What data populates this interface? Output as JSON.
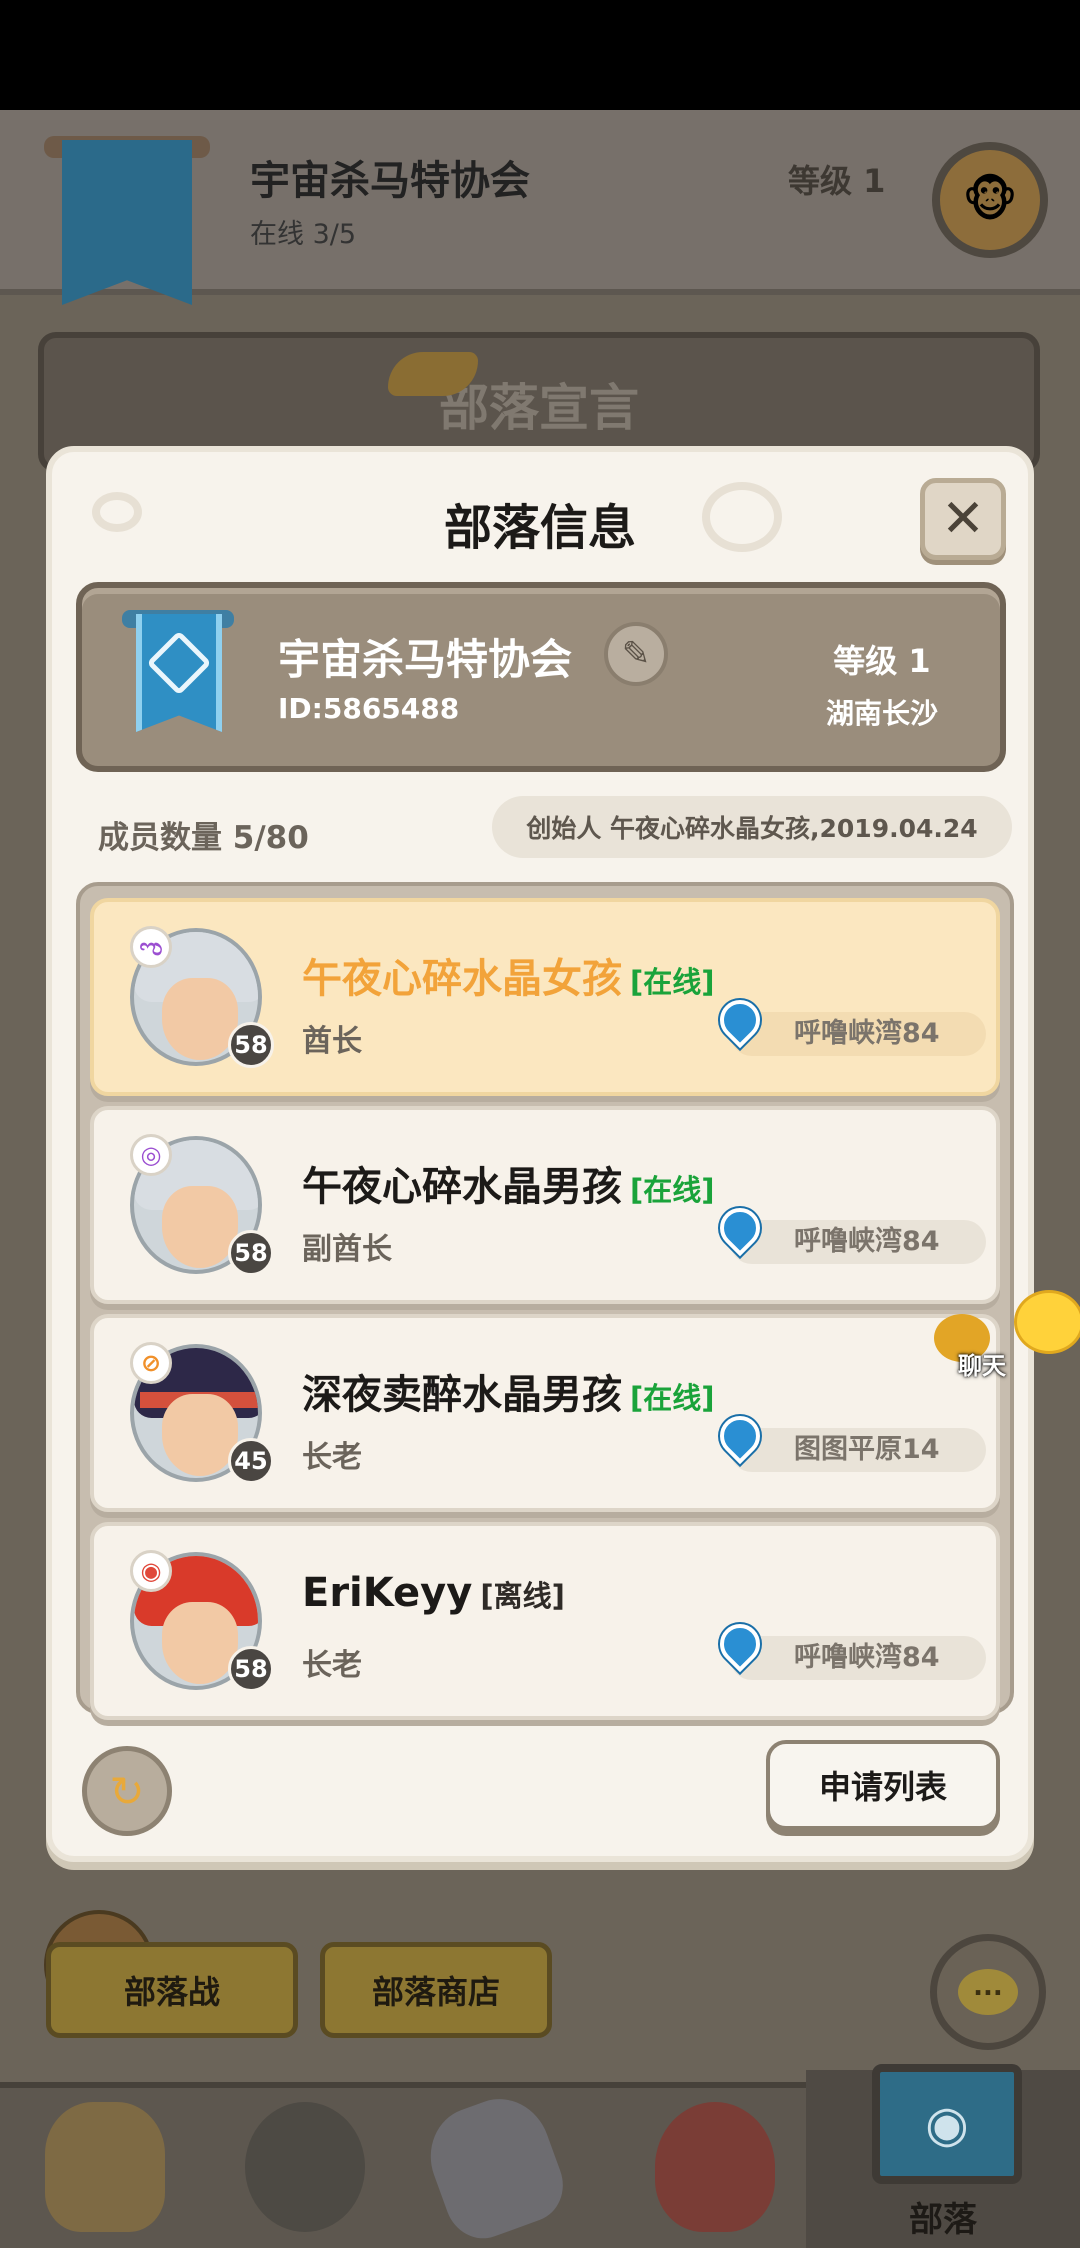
{
  "header": {
    "tribe_name": "宇宙杀马特协会",
    "online": "在线 3/5",
    "level": "等级 1"
  },
  "declaration": {
    "title": "部落宣言"
  },
  "dialog": {
    "title": "部落信息",
    "close_label": "✕",
    "card": {
      "tribe_name": "宇宙杀马特协会",
      "id": "ID:5865488",
      "level": "等级 1",
      "region": "湖南长沙"
    },
    "member_count": "成员数量 5/80",
    "founder": "创始人 午夜心碎水晶女孩,2019.04.24",
    "members": [
      {
        "name": "午夜心碎水晶女孩",
        "status": "[在线]",
        "role": "酋长",
        "level": "58",
        "location": "呼噜峡湾84",
        "badge_icon": "spiral-icon"
      },
      {
        "name": "午夜心碎水晶男孩",
        "status": "[在线]",
        "role": "副酋长",
        "level": "58",
        "location": "呼噜峡湾84",
        "badge_icon": "swirl-icon"
      },
      {
        "name": "深夜卖醉水晶男孩",
        "status": "[在线]",
        "role": "长老",
        "level": "45",
        "location": "图图平原14",
        "badge_icon": "no-entry-icon"
      },
      {
        "name": "EriKeyy",
        "status": "[离线]",
        "role": "长老",
        "level": "58",
        "location": "呼噜峡湾84",
        "badge_icon": "ring-icon"
      }
    ],
    "apply_list_label": "申请列表"
  },
  "float_chat": {
    "label": "聊天"
  },
  "bottom_buttons": {
    "tribe_war": "部落战",
    "tribe_shop": "部落商店"
  },
  "chat_fab": {
    "label": "..."
  },
  "tabs": {
    "tribe_label": "部落"
  },
  "colors": {
    "leader_name": "#f2a33a",
    "online_status": "#1aa33a",
    "location_pin": "#2a8fd3",
    "banner_blue": "#2f8fc4"
  }
}
